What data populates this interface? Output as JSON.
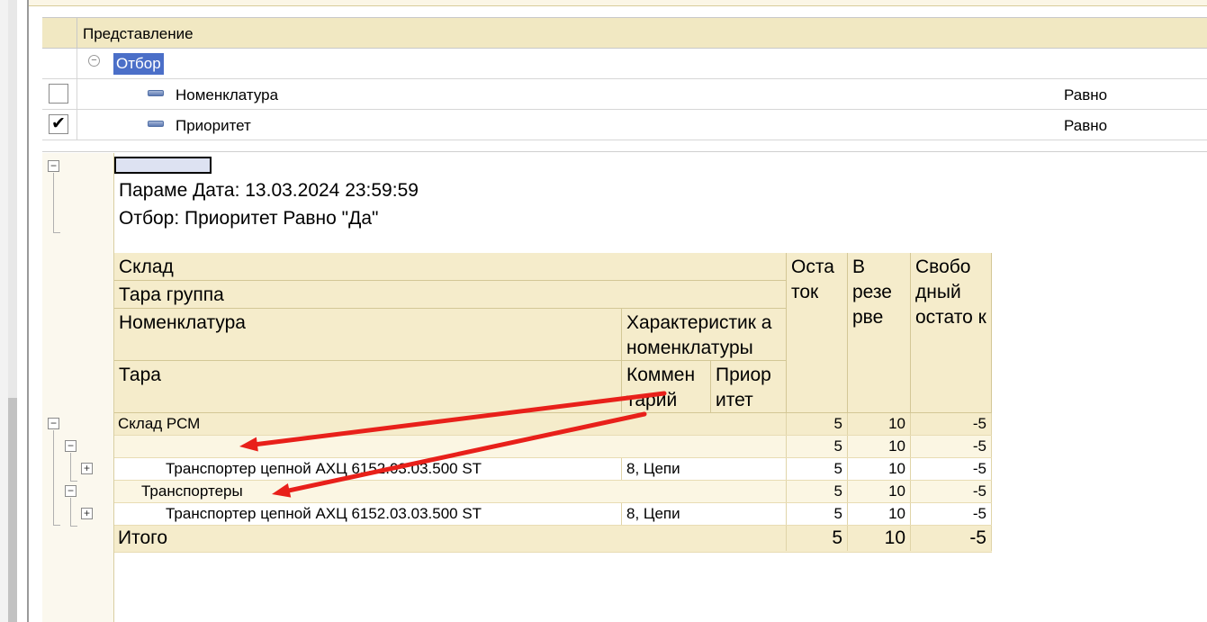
{
  "filter_grid": {
    "header_label": "Представление",
    "group_label": "Отбор",
    "rows": [
      {
        "checked": "",
        "field": "Номенклатура",
        "condition": "Равно"
      },
      {
        "checked": "✔",
        "field": "Приоритет",
        "condition": "Равно"
      }
    ]
  },
  "report": {
    "params_text": "Параме Дата: 13.03.2024 23:59:59",
    "filter_text": "Отбор:   Приоритет Равно \"Да\"",
    "headers": {
      "warehouse": "Склад",
      "container_group": "Тара группа",
      "nomenclature": "Номенклатура",
      "characteristic": "Характеристик а номенклатуры",
      "container": "Тара",
      "comment": "Коммен тарий",
      "priority": "Приор итет",
      "balance": "Оста ток",
      "reserved": "В резе рве",
      "free_balance": "Свобо дный остато к"
    },
    "rows": [
      {
        "name": "Склад РСМ",
        "characteristic": "",
        "balance": "5",
        "reserved": "10",
        "free": "-5"
      },
      {
        "name": "",
        "characteristic": "",
        "balance": "5",
        "reserved": "10",
        "free": "-5"
      },
      {
        "name": "Транспортер цепной АХЦ 6152.03.03.500 ST",
        "characteristic": "8, Цепи",
        "balance": "5",
        "reserved": "10",
        "free": "-5"
      },
      {
        "name": "Транспортеры",
        "characteristic": "",
        "balance": "5",
        "reserved": "10",
        "free": "-5"
      },
      {
        "name": "Транспортер цепной АХЦ 6152.03.03.500 ST",
        "characteristic": "8, Цепи",
        "balance": "5",
        "reserved": "10",
        "free": "-5"
      }
    ],
    "total": {
      "label": "Итого",
      "balance": "5",
      "reserved": "10",
      "free": "-5"
    }
  },
  "annotation_color": "#e8201a",
  "icons": {
    "check": "check-icon",
    "collapse": "minus-box-icon",
    "expand": "plus-box-icon",
    "field": "field-dash-icon"
  }
}
